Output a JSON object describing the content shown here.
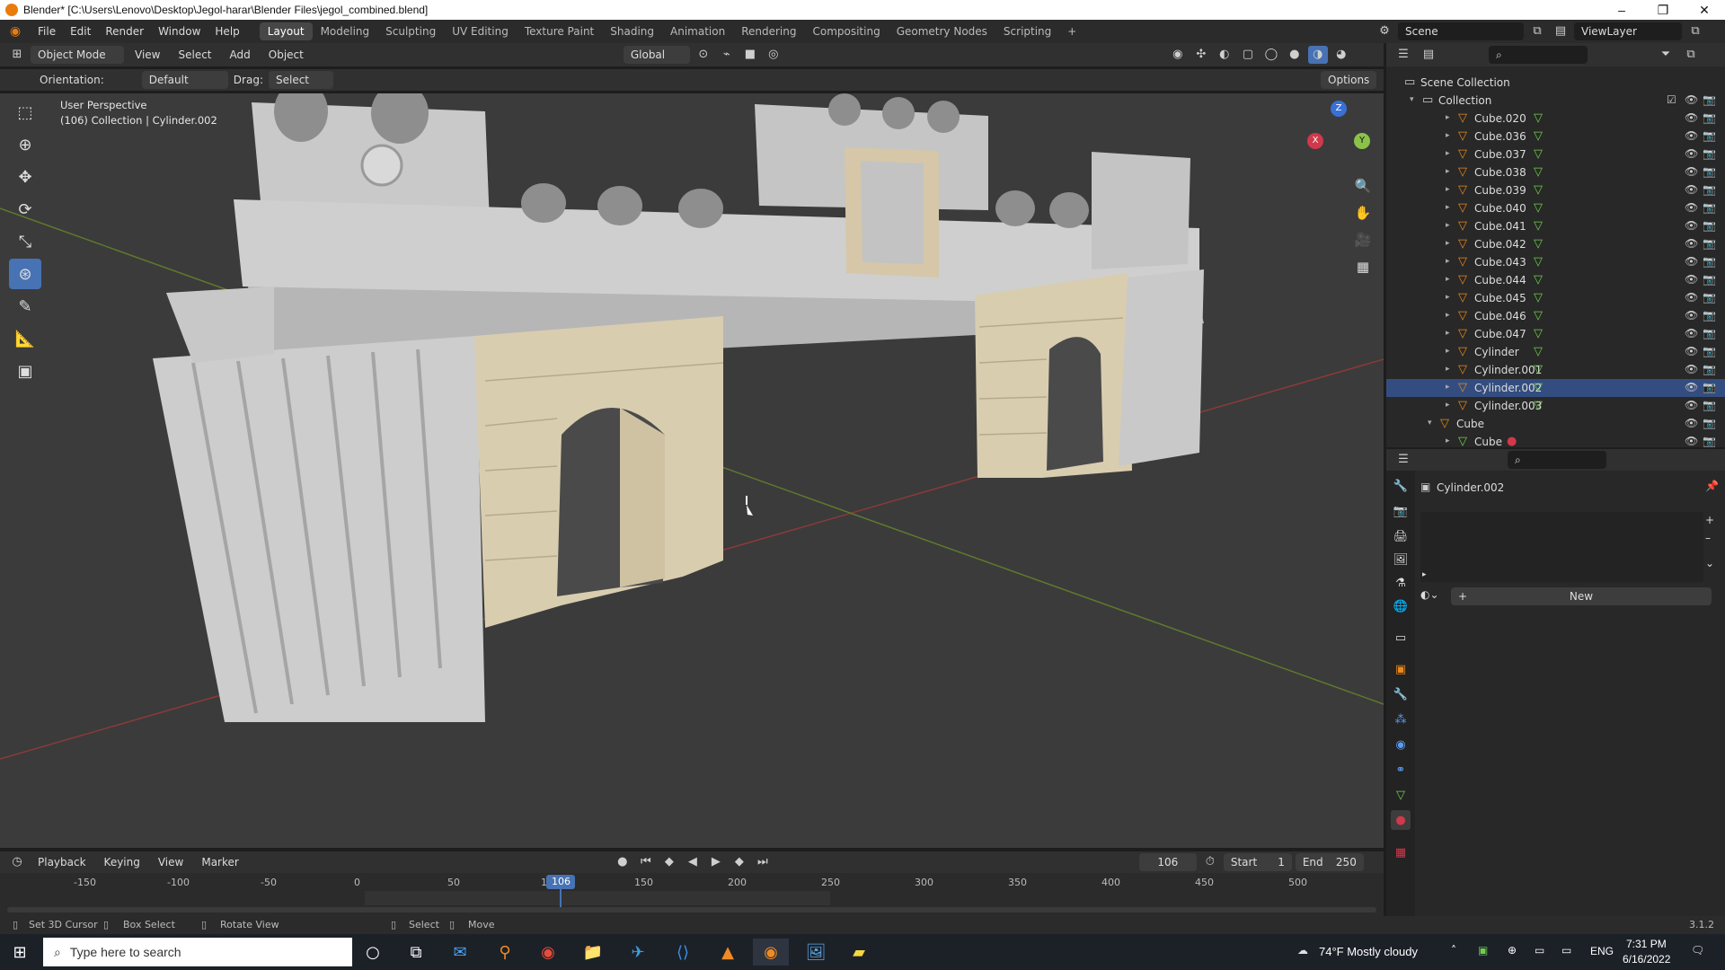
{
  "window": {
    "title": "Blender* [C:\\Users\\Lenovo\\Desktop\\Jegol-harar\\Blender Files\\jegol_combined.blend]",
    "minimize": "–",
    "maximize": "❐",
    "close": "✕"
  },
  "menus": [
    "File",
    "Edit",
    "Render",
    "Window",
    "Help"
  ],
  "workspaces": [
    "Layout",
    "Modeling",
    "Sculpting",
    "UV Editing",
    "Texture Paint",
    "Shading",
    "Animation",
    "Rendering",
    "Compositing",
    "Geometry Nodes",
    "Scripting",
    "+"
  ],
  "scene": {
    "label": "Scene",
    "viewlayer": "ViewLayer"
  },
  "viewport_header": {
    "mode": "Object Mode",
    "view": "View",
    "select": "Select",
    "add": "Add",
    "object": "Object",
    "transform": "Global"
  },
  "tool_header": {
    "orientation_label": "Orientation:",
    "orientation": "Default",
    "drag_label": "Drag:",
    "drag": "Select Box",
    "options": "Options"
  },
  "viewport": {
    "perspective": "User Perspective",
    "collection_info": "(106) Collection | Cylinder.002",
    "gizmo_z": "Z",
    "gizmo_y": "Y",
    "gizmo_x": "X"
  },
  "outliner": {
    "root": "Scene Collection",
    "collection": "Collection",
    "items": [
      "Cube.020",
      "Cube.036",
      "Cube.037",
      "Cube.038",
      "Cube.039",
      "Cube.040",
      "Cube.041",
      "Cube.042",
      "Cube.043",
      "Cube.044",
      "Cube.045",
      "Cube.046",
      "Cube.047",
      "Cylinder",
      "Cylinder.001",
      "Cylinder.002",
      "Cylinder.003"
    ],
    "cube_object": "Cube",
    "cube_mesh": "Cube"
  },
  "properties": {
    "object": "Cylinder.002",
    "new": "New"
  },
  "timeline": {
    "playback": "Playback",
    "keying": "Keying",
    "view": "View",
    "marker": "Marker",
    "frame": "106",
    "start_label": "Start",
    "start": "1",
    "end_label": "End",
    "end": "250",
    "ticks": [
      "-150",
      "-100",
      "-50",
      "0",
      "50",
      "100",
      "150",
      "200",
      "250",
      "300",
      "350",
      "400",
      "450",
      "500"
    ],
    "current": "106"
  },
  "status": {
    "set_cursor": "Set 3D Cursor",
    "box_select": "Box Select",
    "rotate": "Rotate View",
    "select": "Select",
    "move": "Move",
    "version": "3.1.2"
  },
  "taskbar": {
    "search": "Type here to search",
    "weather": "74°F  Mostly cloudy",
    "lang": "ENG",
    "time": "7:31 PM",
    "date": "6/16/2022"
  }
}
